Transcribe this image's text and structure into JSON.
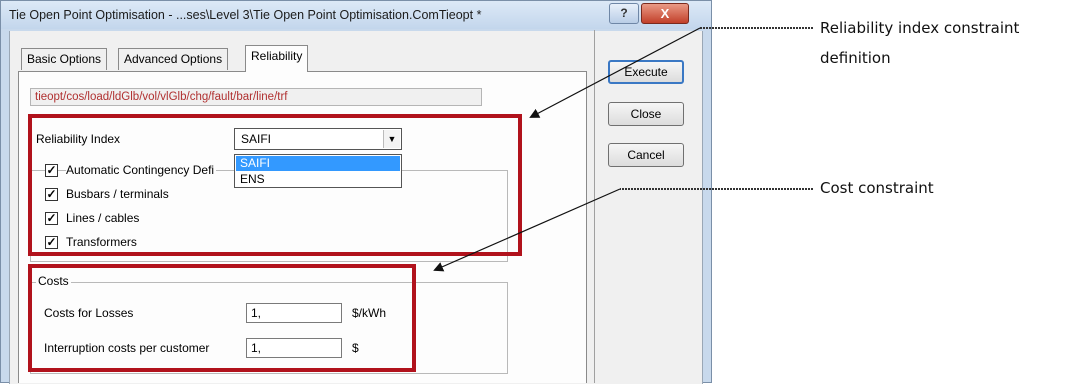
{
  "window": {
    "title": "Tie Open Point Optimisation - ...ses\\Level 3\\Tie Open Point Optimisation.ComTieopt *",
    "help_label": "?",
    "close_label": "X"
  },
  "tabs": [
    {
      "label": "Basic Options"
    },
    {
      "label": "Advanced Options"
    },
    {
      "label": "Reliability"
    }
  ],
  "path_field": "tieopt/cos/load/ldGlb/vol/vlGlb/chg/fault/bar/line/trf",
  "reliability": {
    "label": "Reliability Index",
    "selected": "SAIFI",
    "options": [
      "SAIFI",
      "ENS"
    ]
  },
  "checks": [
    {
      "label": "Automatic Contingency Defi",
      "checked": "✓"
    },
    {
      "label": "Busbars / terminals",
      "checked": "✓"
    },
    {
      "label": "Lines / cables",
      "checked": "✓"
    },
    {
      "label": "Transformers",
      "checked": "✓"
    }
  ],
  "costs": {
    "legend": "Costs",
    "losses_label": "Costs for Losses",
    "losses_value": "1,",
    "losses_unit": "$/kWh",
    "interruption_label": "Interruption costs per customer",
    "interruption_value": "1,",
    "interruption_unit": "$"
  },
  "buttons": {
    "execute": "Execute",
    "close": "Close",
    "cancel": "Cancel"
  },
  "annotations": {
    "reliability_line1": "Reliability index constraint",
    "reliability_line2": "definition",
    "cost": "Cost constraint"
  },
  "colors": {
    "highlight_box": "#b1121c",
    "selection": "#3399ff",
    "path_text": "#b03030"
  }
}
